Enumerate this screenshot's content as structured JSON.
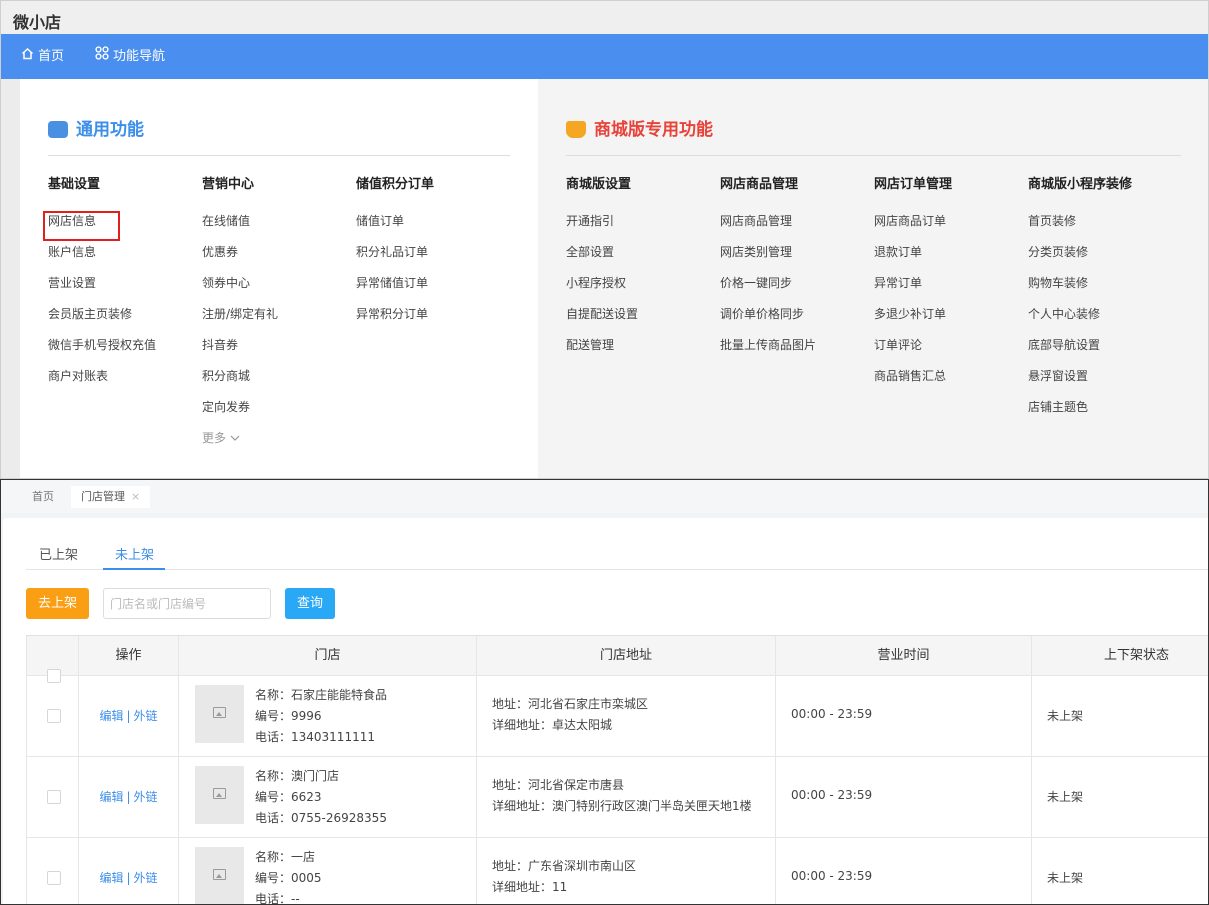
{
  "app": {
    "title": "微小店"
  },
  "nav": {
    "home": "首页",
    "function_nav": "功能导航"
  },
  "general": {
    "title": "通用功能",
    "columns": [
      {
        "head": "基础设置",
        "items": [
          "网店信息",
          "账户信息",
          "营业设置",
          "会员版主页装修",
          "微信手机号授权充值",
          "商户对账表"
        ]
      },
      {
        "head": "营销中心",
        "items": [
          "在线储值",
          "优惠券",
          "领券中心",
          "注册/绑定有礼",
          "抖音券",
          "积分商城",
          "定向发券"
        ],
        "more": "更多"
      },
      {
        "head": "储值积分订单",
        "items": [
          "储值订单",
          "积分礼品订单",
          "异常储值订单",
          "异常积分订单"
        ]
      }
    ]
  },
  "mall": {
    "title": "商城版专用功能",
    "columns": [
      {
        "head": "商城版设置",
        "items": [
          "开通指引",
          "全部设置",
          "小程序授权",
          "自提配送设置",
          "配送管理"
        ]
      },
      {
        "head": "网店商品管理",
        "items": [
          "网店商品管理",
          "网店类别管理",
          "价格一键同步",
          "调价单价格同步",
          "批量上传商品图片"
        ]
      },
      {
        "head": "网店订单管理",
        "items": [
          "网店商品订单",
          "退款订单",
          "异常订单",
          "多退少补订单",
          "订单评论",
          "商品销售汇总"
        ]
      },
      {
        "head": "商城版小程序装修",
        "items": [
          "首页装修",
          "分类页装修",
          "购物车装修",
          "个人中心装修",
          "底部导航设置",
          "悬浮窗设置",
          "店铺主题色"
        ]
      }
    ]
  },
  "page_tabs": {
    "home": "首页",
    "store": "门店管理",
    "close": "×"
  },
  "status_tabs": {
    "listed": "已上架",
    "unlisted": "未上架"
  },
  "toolbar": {
    "list_button": "去上架",
    "search_placeholder": "门店名或门店编号",
    "query_button": "查询"
  },
  "table": {
    "headers": {
      "ops": "操作",
      "store": "门店",
      "address": "门店地址",
      "hours": "营业时间",
      "status": "上下架状态"
    },
    "rows": [
      {
        "edit": "编辑",
        "sep": "|",
        "link": "外链",
        "name": "名称：石家庄能能特食品",
        "code": "编号：9996",
        "phone": "电话：13403111111",
        "addr": "地址：河北省石家庄市栾城区",
        "detail": "详细地址：卓达太阳城",
        "hours": "00:00 - 23:59",
        "status": "未上架"
      },
      {
        "edit": "编辑",
        "sep": "|",
        "link": "外链",
        "name": "名称：澳门门店",
        "code": "编号：6623",
        "phone": "电话：0755-26928355",
        "addr": "地址：河北省保定市唐县",
        "detail": "详细地址：澳门特别行政区澳门半岛关匣天地1楼",
        "hours": "00:00 - 23:59",
        "status": "未上架"
      },
      {
        "edit": "编辑",
        "sep": "|",
        "link": "外链",
        "name": "名称：一店",
        "code": "编号：0005",
        "phone": "电话：--",
        "addr": "地址：广东省深圳市南山区",
        "detail": "详细地址：11",
        "hours": "00:00 - 23:59",
        "status": "未上架"
      }
    ]
  }
}
